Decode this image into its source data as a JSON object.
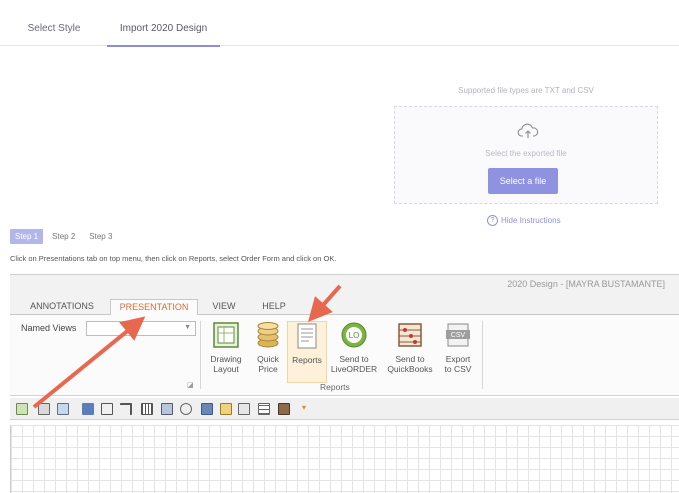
{
  "tabs": [
    {
      "label": "Select Style"
    },
    {
      "label": "Import 2020 Design"
    }
  ],
  "upload": {
    "supported_text": "Supported file types are TXT and CSV",
    "dropzone_text": "Select the exported file",
    "select_button": "Select a file",
    "hide_instructions": "Hide Instructions"
  },
  "steps": [
    "Step 1",
    "Step 2",
    "Step 3"
  ],
  "instruction": "Click on Presentations tab on top menu, then click on Reports, select Order Form and click on OK.",
  "screenshot": {
    "title": "2020 Design - [MAYRA BUSTAMANTE]",
    "ribbon_tabs": [
      "ANNOTATIONS",
      "PRESENTATION",
      "VIEW",
      "HELP"
    ],
    "named_views_label": "Named Views",
    "buttons": [
      {
        "line1": "Drawing",
        "line2": "Layout"
      },
      {
        "line1": "Quick",
        "line2": "Price"
      },
      {
        "line1": "Reports",
        "line2": ""
      },
      {
        "line1": "Send to",
        "line2": "LiveORDER"
      },
      {
        "line1": "Send to",
        "line2": "QuickBooks"
      },
      {
        "line1": "Export",
        "line2": "to CSV"
      }
    ],
    "group_label": "Reports",
    "colors": {
      "accent": "#8e92e0",
      "active_tab": "#d56f3a",
      "arrow": "#e8684f"
    }
  }
}
